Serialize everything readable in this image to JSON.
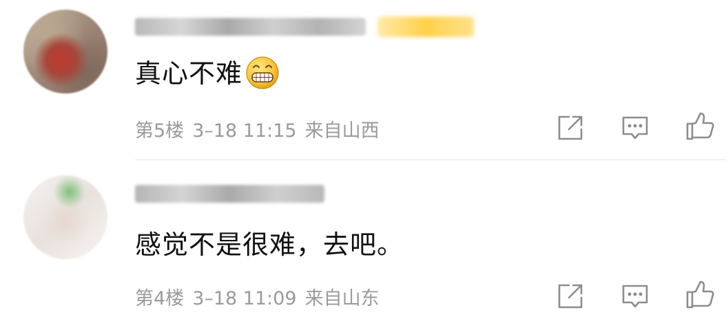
{
  "comments": [
    {
      "content": "真心不难",
      "floor": "第5楼",
      "time": "3–18 11:15",
      "location": "来自山西",
      "emoji": "grinning-emoji"
    },
    {
      "content": "感觉不是很难，去吧。",
      "floor": "第4楼",
      "time": "3–18 11:09",
      "location": "来自山东"
    }
  ],
  "actions": {
    "share_icon": "share-icon",
    "reply_icon": "comment-icon",
    "like_icon": "thumbs-up-icon"
  },
  "colors": {
    "text_primary": "#111111",
    "text_secondary": "#9a9a9a",
    "icon": "#8c8c8c",
    "divider": "#e6e6e6",
    "vip_gold": "#ffd14a"
  }
}
